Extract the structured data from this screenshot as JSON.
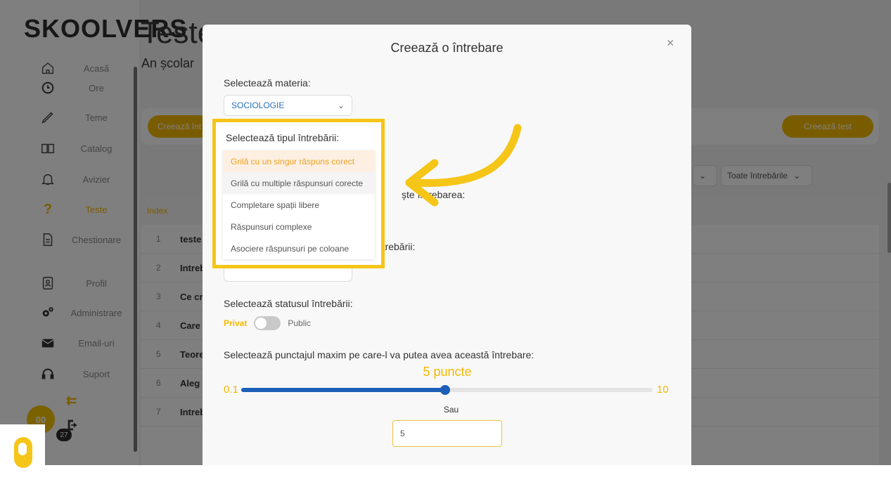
{
  "app": {
    "logo": "SKOOLVERS"
  },
  "sidebar": {
    "items": [
      {
        "label": "Acasă",
        "icon": "home-icon"
      },
      {
        "label": "Ore",
        "icon": "clock-icon"
      },
      {
        "label": "Teme",
        "icon": "pencil-icon"
      },
      {
        "label": "Catalog",
        "icon": "book-icon"
      },
      {
        "label": "Avizier",
        "icon": "bell-icon"
      },
      {
        "label": "Teste",
        "icon": "question-icon",
        "active": true
      },
      {
        "label": "Chestionare",
        "icon": "document-icon"
      },
      {
        "label": "Profil",
        "icon": "profile-icon"
      },
      {
        "label": "Administrare",
        "icon": "gears-icon"
      },
      {
        "label": "Email-uri",
        "icon": "mail-icon"
      },
      {
        "label": "Suport",
        "icon": "headset-icon"
      }
    ],
    "user_initials": "00",
    "notification_count": "27"
  },
  "page": {
    "title": "Teste",
    "subtitle": "An școlar",
    "create_question_button": "Creează înt",
    "create_test_button": "Creează test",
    "filter_all_questions": "Toate întrebările",
    "table": {
      "index_header": "Index",
      "rows": [
        {
          "index": "1",
          "text": "teste"
        },
        {
          "index": "2",
          "text": "Intreb"
        },
        {
          "index": "3",
          "text": "Ce cr"
        },
        {
          "index": "4",
          "text": "Care"
        },
        {
          "index": "5",
          "text": "Teore"
        },
        {
          "index": "6",
          "text": "Aleg"
        },
        {
          "index": "7",
          "text": "Intreb"
        }
      ]
    }
  },
  "modal": {
    "title": "Creează o întrebare",
    "close": "×",
    "subject_label": "Selectează materia:",
    "subject_value": "SOCIOLOGIE",
    "hidden_label_1": "ște întrebarea:",
    "hidden_label_2": "întrebării:",
    "status_label": "Selectează statusul întrebării:",
    "status_private": "Privat",
    "status_public": "Public",
    "points_label": "Selectează punctajul maxim pe care-l va putea avea această întrebare:",
    "points_display": "5 puncte",
    "slider_min": "0.1",
    "slider_max": "10",
    "slider_value_fraction": 0.495,
    "or_label": "Sau",
    "points_input_value": "5"
  },
  "dropdown": {
    "label": "Selectează tipul întrebării:",
    "options": [
      "Grilă cu un singur răspuns corect",
      "Grilă cu multiple răspunsuri corecte",
      "Completare spații libere",
      "Răspunsuri complexe",
      "Asociere răspunsuri pe coloane"
    ],
    "selected_index": 0
  },
  "colors": {
    "accent": "#f5b800",
    "highlight": "#f5c518",
    "slider": "#1c5fb8"
  }
}
